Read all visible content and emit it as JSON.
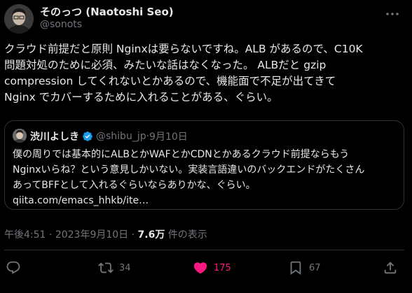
{
  "author": {
    "name": "そのっつ (Naotoshi Seo)",
    "handle": "@sonots"
  },
  "tweet": {
    "text": "クラウド前提だと原則 Nginxは要らないですね。ALB があるので、C10K\n問題対処のために必須、みたいな話はなくなった。 ALBだと gzip\ncompression してくれないとかあるので、機能面で不足が出てきて\nNginx でカバーするために入れることがある、ぐらい。"
  },
  "quote": {
    "name": "渋川よしき",
    "handle": "@shibu_jp",
    "separator": " · ",
    "date": "9月10日",
    "text": "僕の周りでは基本的にALBとかWAFとかCDNとかあるクラウド前提ならもう\nNginxいらね？という意見しかいない。実装言語違いのバックエンドがたくさん\nあってBFFとして入れるぐらいならありかな、ぐらい。\nqiita.com/emacs_hhkb/ite…"
  },
  "meta": {
    "time": "午後4:51",
    "separator": " · ",
    "date": "2023年9月10日",
    "separator2": " · ",
    "views_count": "7.6万",
    "views_label": " 件の表示"
  },
  "actions": {
    "retweets": "34",
    "likes": "175",
    "bookmarks": "67"
  },
  "colors": {
    "background": "#000000",
    "text": "#e7e9ea",
    "secondary": "#71767b",
    "like": "#f91880",
    "verified": "#1d9bf0",
    "border": "#2f3336"
  }
}
